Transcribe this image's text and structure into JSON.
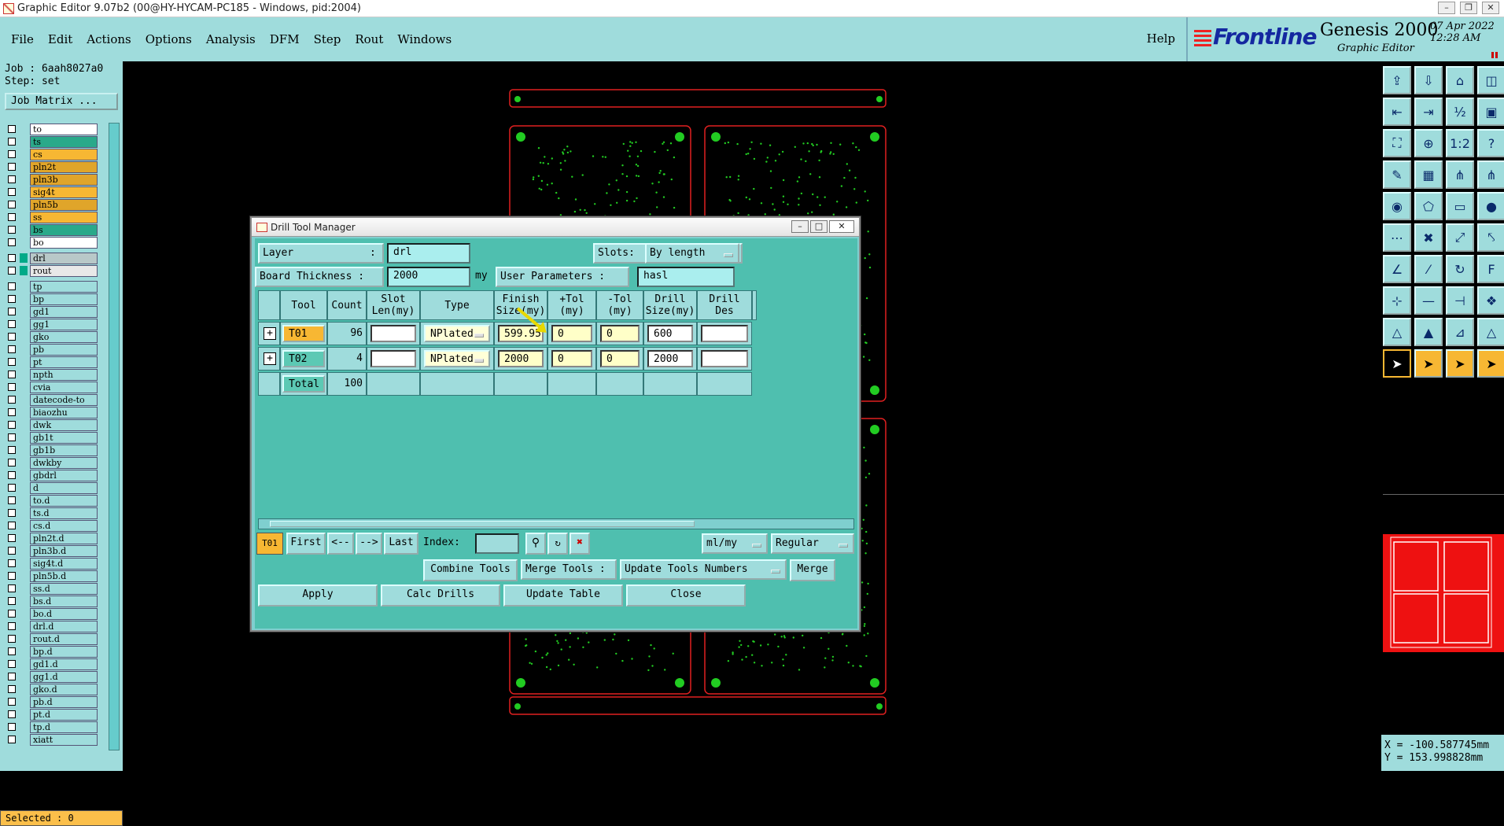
{
  "window": {
    "title": "Graphic Editor 9.07b2 (00@HY-HYCAM-PC185 - Windows, pid:2004)"
  },
  "menu": {
    "items": [
      "File",
      "Edit",
      "Actions",
      "Options",
      "Analysis",
      "DFM",
      "Step",
      "Rout",
      "Windows"
    ],
    "help": "Help"
  },
  "brand": {
    "logo": "Frontline",
    "product": "Genesis 2000",
    "subtitle": "Graphic Editor",
    "date": "07 Apr 2022",
    "time": "12:28 AM"
  },
  "job": {
    "job_line": "Job : 6aah8027a0",
    "step_line": "Step: set",
    "matrix_button": "Job Matrix ..."
  },
  "layers_top": [
    {
      "name": "to",
      "color": "#ffffff"
    },
    {
      "name": "ts",
      "color": "#2aa98a"
    },
    {
      "name": "cs",
      "color": "#f7b733"
    },
    {
      "name": "pln2t",
      "color": "#e0a52a"
    },
    {
      "name": "pln3b",
      "color": "#e0a52a"
    },
    {
      "name": "sig4t",
      "color": "#f7b733"
    },
    {
      "name": "pln5b",
      "color": "#e0a52a"
    },
    {
      "name": "ss",
      "color": "#f7b733"
    },
    {
      "name": "bs",
      "color": "#2aa98a"
    },
    {
      "name": "bo",
      "color": "#ffffff"
    }
  ],
  "layers_drill": [
    {
      "name": "drl",
      "color": "#b8c8c8"
    },
    {
      "name": "rout",
      "color": "#e8e8e8"
    }
  ],
  "layers_other": [
    "tp",
    "bp",
    "gd1",
    "gg1",
    "gko",
    "pb",
    "pt",
    "npth",
    "cvia",
    "datecode-to",
    "biaozhu",
    "dwk",
    "gb1t",
    "gb1b",
    "dwkby",
    "gbdrl",
    "d",
    "to.d",
    "ts.d",
    "cs.d",
    "pln2t.d",
    "pln3b.d",
    "sig4t.d",
    "pln5b.d",
    "ss.d",
    "bs.d",
    "bo.d",
    "drl.d",
    "rout.d",
    "bp.d",
    "gd1.d",
    "gg1.d",
    "gko.d",
    "pb.d",
    "pt.d",
    "tp.d",
    "xiatt"
  ],
  "selected": "Selected : 0",
  "coords": {
    "x": "X = -100.587745mm",
    "y": "Y = 153.998828mm"
  },
  "dialog": {
    "title": "Drill Tool Manager",
    "layer_label": "Layer",
    "layer_colon": ":",
    "layer_value": "drl",
    "slots_label": "Slots:",
    "slots_value": "By length",
    "thickness_label": "Board Thickness :",
    "thickness_value": "2000",
    "thickness_unit": "my",
    "user_params_label": "User Parameters :",
    "user_params_value": "hasl",
    "columns": [
      "Tool",
      "Count",
      "Slot\nLen(my)",
      "Type",
      "Finish\nSize(my)",
      "+Tol\n(my)",
      "-Tol\n(my)",
      "Drill\nSize(my)",
      "Drill\nDes"
    ],
    "rows": [
      {
        "tool": "T01",
        "count": "96",
        "slot_len": "",
        "type": "NPlated",
        "finish": "599.95",
        "ptol": "0",
        "mtol": "0",
        "drill": "600",
        "des": ""
      },
      {
        "tool": "T02",
        "count": "4",
        "slot_len": "",
        "type": "NPlated",
        "finish": "2000",
        "ptol": "0",
        "mtol": "0",
        "drill": "2000",
        "des": ""
      }
    ],
    "total_label": "Total",
    "total_count": "100",
    "nav": {
      "current": "T01",
      "first": "First",
      "prev": "<--",
      "next": "-->",
      "last": "Last",
      "index_label": "Index:",
      "units": "ml/my",
      "mode": "Regular"
    },
    "combine": "Combine Tools",
    "merge_label": "Merge Tools :",
    "update_numbers": "Update Tools Numbers",
    "merge": "Merge",
    "apply": "Apply",
    "calc": "Calc Drills",
    "update_table": "Update Table",
    "close": "Close"
  },
  "colors": {
    "accent": "#9fdcdc",
    "panel_green": "#4fbfaf",
    "board_outline": "#e02020",
    "pad_green": "#22cc22",
    "highlight": "#f7b733"
  }
}
